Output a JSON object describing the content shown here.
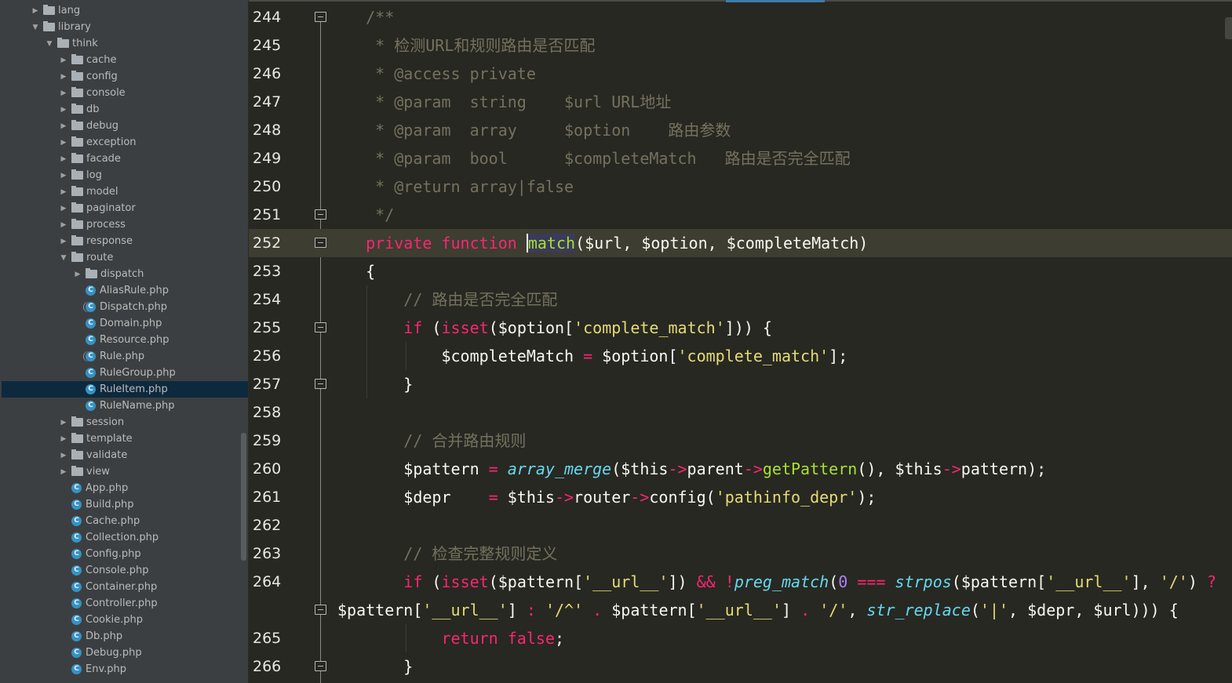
{
  "sidebar": {
    "selected": "RuleItem.php",
    "items": [
      {
        "label": "lang",
        "depth": 0,
        "type": "dir",
        "expanded": false
      },
      {
        "label": "library",
        "depth": 0,
        "type": "dir",
        "expanded": true
      },
      {
        "label": "think",
        "depth": 1,
        "type": "dir",
        "expanded": true
      },
      {
        "label": "cache",
        "depth": 2,
        "type": "dir",
        "expanded": false
      },
      {
        "label": "config",
        "depth": 2,
        "type": "dir",
        "expanded": false
      },
      {
        "label": "console",
        "depth": 2,
        "type": "dir",
        "expanded": false
      },
      {
        "label": "db",
        "depth": 2,
        "type": "dir",
        "expanded": false
      },
      {
        "label": "debug",
        "depth": 2,
        "type": "dir",
        "expanded": false
      },
      {
        "label": "exception",
        "depth": 2,
        "type": "dir",
        "expanded": false
      },
      {
        "label": "facade",
        "depth": 2,
        "type": "dir",
        "expanded": false
      },
      {
        "label": "log",
        "depth": 2,
        "type": "dir",
        "expanded": false
      },
      {
        "label": "model",
        "depth": 2,
        "type": "dir",
        "expanded": false
      },
      {
        "label": "paginator",
        "depth": 2,
        "type": "dir",
        "expanded": false
      },
      {
        "label": "process",
        "depth": 2,
        "type": "dir",
        "expanded": false
      },
      {
        "label": "response",
        "depth": 2,
        "type": "dir",
        "expanded": false
      },
      {
        "label": "route",
        "depth": 2,
        "type": "dir",
        "expanded": true
      },
      {
        "label": "dispatch",
        "depth": 3,
        "type": "dir",
        "expanded": false
      },
      {
        "label": "AliasRule.php",
        "depth": 3,
        "type": "class"
      },
      {
        "label": "Dispatch.php",
        "depth": 3,
        "type": "abstract"
      },
      {
        "label": "Domain.php",
        "depth": 3,
        "type": "class"
      },
      {
        "label": "Resource.php",
        "depth": 3,
        "type": "class"
      },
      {
        "label": "Rule.php",
        "depth": 3,
        "type": "abstract"
      },
      {
        "label": "RuleGroup.php",
        "depth": 3,
        "type": "class"
      },
      {
        "label": "RuleItem.php",
        "depth": 3,
        "type": "class"
      },
      {
        "label": "RuleName.php",
        "depth": 3,
        "type": "class"
      },
      {
        "label": "session",
        "depth": 2,
        "type": "dir",
        "expanded": false
      },
      {
        "label": "template",
        "depth": 2,
        "type": "dir",
        "expanded": false
      },
      {
        "label": "validate",
        "depth": 2,
        "type": "dir",
        "expanded": false
      },
      {
        "label": "view",
        "depth": 2,
        "type": "dir",
        "expanded": false
      },
      {
        "label": "App.php",
        "depth": 2,
        "type": "class"
      },
      {
        "label": "Build.php",
        "depth": 2,
        "type": "class"
      },
      {
        "label": "Cache.php",
        "depth": 2,
        "type": "class"
      },
      {
        "label": "Collection.php",
        "depth": 2,
        "type": "class"
      },
      {
        "label": "Config.php",
        "depth": 2,
        "type": "class"
      },
      {
        "label": "Console.php",
        "depth": 2,
        "type": "class"
      },
      {
        "label": "Container.php",
        "depth": 2,
        "type": "class"
      },
      {
        "label": "Controller.php",
        "depth": 2,
        "type": "class"
      },
      {
        "label": "Cookie.php",
        "depth": 2,
        "type": "class"
      },
      {
        "label": "Db.php",
        "depth": 2,
        "type": "class"
      },
      {
        "label": "Debug.php",
        "depth": 2,
        "type": "class"
      },
      {
        "label": "Env.php",
        "depth": 2,
        "type": "class"
      }
    ]
  },
  "icons": {
    "dir": "folder-icon",
    "class": "php-class-icon",
    "abstract": "php-abstract-class-icon",
    "expand": "chevron-right-icon",
    "collapse": "chevron-down-icon"
  },
  "colors": {
    "keyword": "#f92672",
    "function": "#a6e22e",
    "builtin": "#66d9ef",
    "string": "#e6db74",
    "comment": "#75715e",
    "number": "#ae81ff",
    "text": "#f8f8f2",
    "background": "#272822",
    "current_line": "#3e3d32"
  },
  "editor": {
    "current_line": "252",
    "lines": [
      {
        "num": "244",
        "fold": "open",
        "tokens": [
          [
            "c",
            "   /**"
          ]
        ]
      },
      {
        "num": "245",
        "tokens": [
          [
            "c",
            "    * 检测URL和规则路由是否匹配"
          ]
        ]
      },
      {
        "num": "246",
        "tokens": [
          [
            "c",
            "    * @access private"
          ]
        ]
      },
      {
        "num": "247",
        "tokens": [
          [
            "c",
            "    * @param  string    $url URL地址"
          ]
        ]
      },
      {
        "num": "248",
        "tokens": [
          [
            "c",
            "    * @param  array     $option    路由参数"
          ]
        ]
      },
      {
        "num": "249",
        "tokens": [
          [
            "c",
            "    * @param  bool      $completeMatch   路由是否完全匹配"
          ]
        ]
      },
      {
        "num": "250",
        "tokens": [
          [
            "c",
            "    * @return array|false"
          ]
        ]
      },
      {
        "num": "251",
        "fold": "close",
        "tokens": [
          [
            "c",
            "    */"
          ]
        ]
      },
      {
        "num": "252",
        "fold": "open",
        "tokens": [
          [
            "t",
            "   "
          ],
          [
            "k",
            "private"
          ],
          [
            "t",
            " "
          ],
          [
            "k",
            "function"
          ],
          [
            "t",
            " "
          ],
          [
            "sel",
            "match"
          ],
          [
            "t",
            "($url, $option, $completeMatch)"
          ]
        ]
      },
      {
        "num": "253",
        "tokens": [
          [
            "t",
            "   {"
          ]
        ]
      },
      {
        "num": "254",
        "tokens": [
          [
            "c",
            "       // 路由是否完全匹配"
          ]
        ]
      },
      {
        "num": "255",
        "fold": "open",
        "tokens": [
          [
            "t",
            "       "
          ],
          [
            "k",
            "if"
          ],
          [
            "t",
            " ("
          ],
          [
            "k",
            "isset"
          ],
          [
            "t",
            "($option["
          ],
          [
            "s",
            "'complete_match'"
          ],
          [
            "t",
            "])) {"
          ]
        ]
      },
      {
        "num": "256",
        "tokens": [
          [
            "t",
            "           $completeMatch "
          ],
          [
            "o",
            "="
          ],
          [
            "t",
            " $option["
          ],
          [
            "s",
            "'complete_match'"
          ],
          [
            "t",
            "];"
          ]
        ]
      },
      {
        "num": "257",
        "fold": "close",
        "tokens": [
          [
            "t",
            "       }"
          ]
        ]
      },
      {
        "num": "258",
        "tokens": []
      },
      {
        "num": "259",
        "tokens": [
          [
            "c",
            "       // 合并路由规则"
          ]
        ]
      },
      {
        "num": "260",
        "tokens": [
          [
            "t",
            "       $pattern "
          ],
          [
            "o",
            "="
          ],
          [
            "t",
            " "
          ],
          [
            "b",
            "array_merge"
          ],
          [
            "t",
            "($this"
          ],
          [
            "o",
            "->"
          ],
          [
            "t",
            "parent"
          ],
          [
            "o",
            "->"
          ],
          [
            "f",
            "getPattern"
          ],
          [
            "t",
            "(), $this"
          ],
          [
            "o",
            "->"
          ],
          [
            "t",
            "pattern);"
          ]
        ]
      },
      {
        "num": "261",
        "tokens": [
          [
            "t",
            "       $depr    "
          ],
          [
            "o",
            "="
          ],
          [
            "t",
            " $this"
          ],
          [
            "o",
            "->"
          ],
          [
            "t",
            "router"
          ],
          [
            "o",
            "->"
          ],
          [
            "t",
            "config("
          ],
          [
            "s",
            "'pathinfo_depr'"
          ],
          [
            "t",
            ");"
          ]
        ]
      },
      {
        "num": "262",
        "tokens": []
      },
      {
        "num": "263",
        "tokens": [
          [
            "c",
            "       // 检查完整规则定义"
          ]
        ]
      },
      {
        "num": "264",
        "tokens": [
          [
            "t",
            "       "
          ],
          [
            "k",
            "if"
          ],
          [
            "t",
            " ("
          ],
          [
            "k",
            "isset"
          ],
          [
            "t",
            "($pattern["
          ],
          [
            "s",
            "'__url__'"
          ],
          [
            "t",
            "]) "
          ],
          [
            "o",
            "&&"
          ],
          [
            "t",
            " "
          ],
          [
            "o",
            "!"
          ],
          [
            "b",
            "preg_match"
          ],
          [
            "t",
            "("
          ],
          [
            "n",
            "0"
          ],
          [
            "t",
            " "
          ],
          [
            "o",
            "==="
          ],
          [
            "t",
            " "
          ],
          [
            "b",
            "strpos"
          ],
          [
            "t",
            "($pattern["
          ],
          [
            "s",
            "'__url__'"
          ],
          [
            "t",
            "], "
          ],
          [
            "s",
            "'/'"
          ],
          [
            "t",
            ") "
          ],
          [
            "o",
            "?"
          ]
        ]
      },
      {
        "num": "",
        "fold": "close",
        "tokens": [
          [
            "t",
            "$pattern["
          ],
          [
            "s",
            "'__url__'"
          ],
          [
            "t",
            "] "
          ],
          [
            "o",
            ":"
          ],
          [
            "t",
            " "
          ],
          [
            "s",
            "'/^'"
          ],
          [
            "t",
            " "
          ],
          [
            "o",
            "."
          ],
          [
            "t",
            " $pattern["
          ],
          [
            "s",
            "'__url__'"
          ],
          [
            "t",
            "] "
          ],
          [
            "o",
            "."
          ],
          [
            "t",
            " "
          ],
          [
            "s",
            "'/'"
          ],
          [
            "t",
            ", "
          ],
          [
            "b",
            "str_replace"
          ],
          [
            "t",
            "("
          ],
          [
            "s",
            "'|'"
          ],
          [
            "t",
            ", $depr, $url))) {"
          ]
        ]
      },
      {
        "num": "265",
        "tokens": [
          [
            "t",
            "           "
          ],
          [
            "k",
            "return"
          ],
          [
            "t",
            " "
          ],
          [
            "k",
            "false"
          ],
          [
            "t",
            ";"
          ]
        ]
      },
      {
        "num": "266",
        "fold": "close",
        "tokens": [
          [
            "t",
            "       }"
          ]
        ]
      }
    ]
  }
}
